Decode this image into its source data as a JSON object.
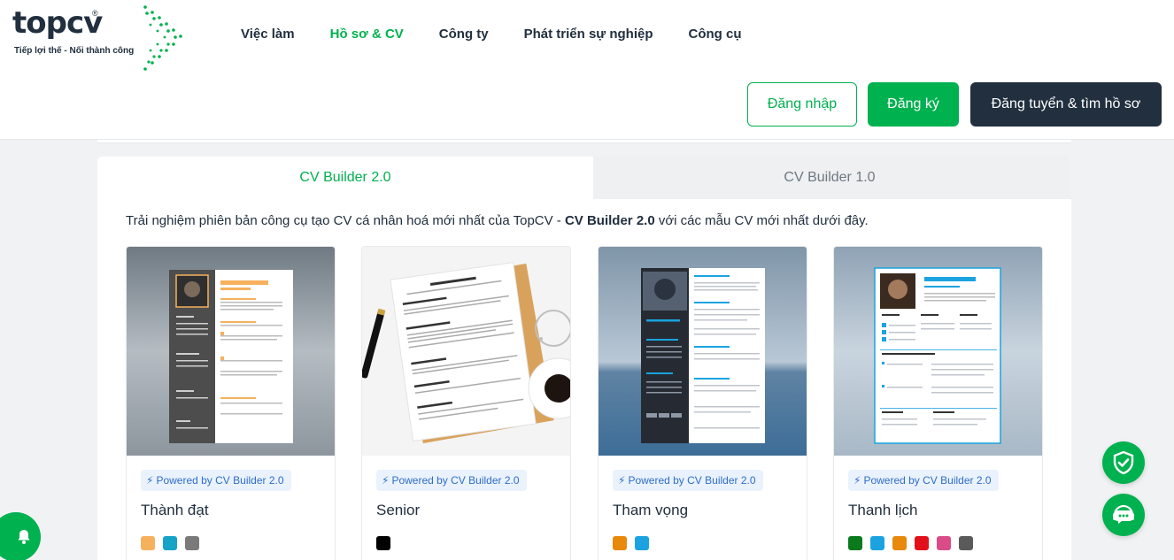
{
  "brand": {
    "logo_top": "top",
    "logo_cv": "cv",
    "logo_reg": "®",
    "tagline": "Tiếp lợi thế - Nối thành công",
    "color": "#00b14f"
  },
  "nav": {
    "items": [
      {
        "label": "Việc làm"
      },
      {
        "label": "Hồ sơ & CV"
      },
      {
        "label": "Công ty"
      },
      {
        "label": "Phát triển sự nghiệp"
      },
      {
        "label": "Công cụ"
      }
    ]
  },
  "auth": {
    "login": "Đăng nhập",
    "register": "Đăng ký",
    "employer": "Đăng tuyển & tìm hồ sơ"
  },
  "tabs": {
    "active": "CV Builder 2.0",
    "inactive": "CV Builder 1.0"
  },
  "intro": {
    "prefix": "Trải nghiệm phiên bản công cụ tạo CV cá nhân hoá mới nhất của TopCV - ",
    "bold": "CV Builder 2.0",
    "suffix": " với các mẫu CV mới nhất dưới đây."
  },
  "templates": [
    {
      "name": "Thành đạt",
      "badge": "Powered by CV Builder 2.0",
      "colors": [
        "#f6b15d",
        "#17a2c8",
        "#7a7a7a"
      ]
    },
    {
      "name": "Senior",
      "badge": "Powered by CV Builder 2.0",
      "colors": [
        "#000000"
      ]
    },
    {
      "name": "Tham vọng",
      "badge": "Powered by CV Builder 2.0",
      "colors": [
        "#e8890c",
        "#1aa3e0"
      ]
    },
    {
      "name": "Thanh lịch",
      "badge": "Powered by CV Builder 2.0",
      "colors": [
        "#0b7a1d",
        "#1aa3e0",
        "#e8890c",
        "#e3101a",
        "#d94c87",
        "#5a5a5a"
      ]
    }
  ],
  "icons": {
    "bell": "bell-icon",
    "shield": "shield-check-icon",
    "chat": "chat-support-icon",
    "bolt": "lightning-icon"
  }
}
